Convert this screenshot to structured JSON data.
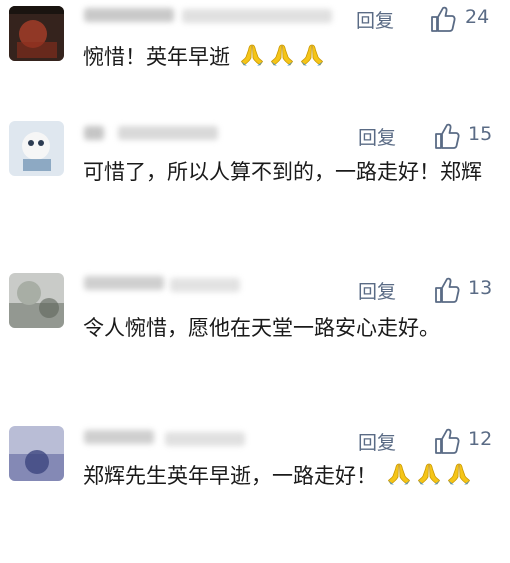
{
  "comments": [
    {
      "reply_label": "回复",
      "like_count": "24",
      "text": "惋惜！英年早逝",
      "trailing_emoji": [
        "folded-hands",
        "folded-hands",
        "folded-hands"
      ],
      "avatar_colors": [
        "#2a1f1a",
        "#7a1f12",
        "#3c3a35"
      ]
    },
    {
      "reply_label": "回复",
      "like_count": "15",
      "text": "可惜了，所以人算不到的，一路走好！郑辉",
      "trailing_emoji": [],
      "avatar_colors": [
        "#dfe7ef",
        "#6a8fb0",
        "#f4f4f4"
      ]
    },
    {
      "reply_label": "回复",
      "like_count": "13",
      "text": "令人惋惜，愿他在天堂一路安心走好。",
      "trailing_emoji": [],
      "avatar_colors": [
        "#c9cbc8",
        "#7c8279",
        "#a8aea5"
      ]
    },
    {
      "reply_label": "回复",
      "like_count": "12",
      "text": "郑辉先生英年早逝，一路走好！",
      "trailing_emoji": [
        "folded-hands",
        "folded-hands",
        "folded-hands"
      ],
      "avatar_colors": [
        "#b9bdd6",
        "#6d73a6",
        "#3d4680"
      ]
    }
  ],
  "colors": {
    "action_text": "#5a6b85",
    "comment_text": "#1a1a1a",
    "emoji_yellow": "#f5c518"
  }
}
